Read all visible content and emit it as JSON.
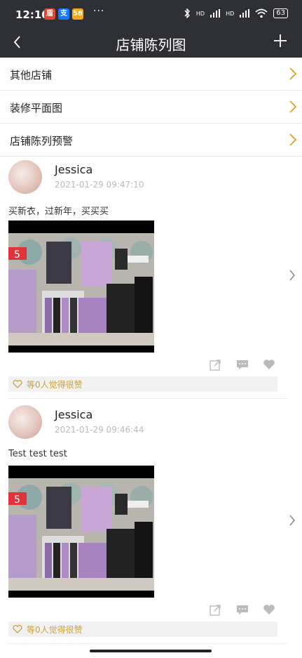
{
  "status_bar": {
    "time": "12:10",
    "dots": "···",
    "badge_1": "盾",
    "badge_2": "支",
    "badge_3": "58",
    "hd_1": "HD",
    "hd_2": "HD",
    "battery": "63"
  },
  "nav": {
    "title": "店铺陈列图"
  },
  "menu": [
    {
      "label": "其他店铺"
    },
    {
      "label": "装修平面图"
    },
    {
      "label": "店铺陈列预警"
    }
  ],
  "posts": [
    {
      "author": "Jessica",
      "timestamp": "2021-01-29 09:47:10",
      "caption": "买新衣，过新年，买买买",
      "photo_price_tag": "5",
      "likes_text": "等0人觉得很赞"
    },
    {
      "author": "Jessica",
      "timestamp": "2021-01-29 09:46:44",
      "caption": "Test test test",
      "photo_price_tag": "5",
      "likes_text": "等0人觉得很赞"
    }
  ],
  "colors": {
    "header_bg": "#2f3035",
    "chevron_accent": "#e0a020",
    "like_text": "#c9a13e"
  }
}
